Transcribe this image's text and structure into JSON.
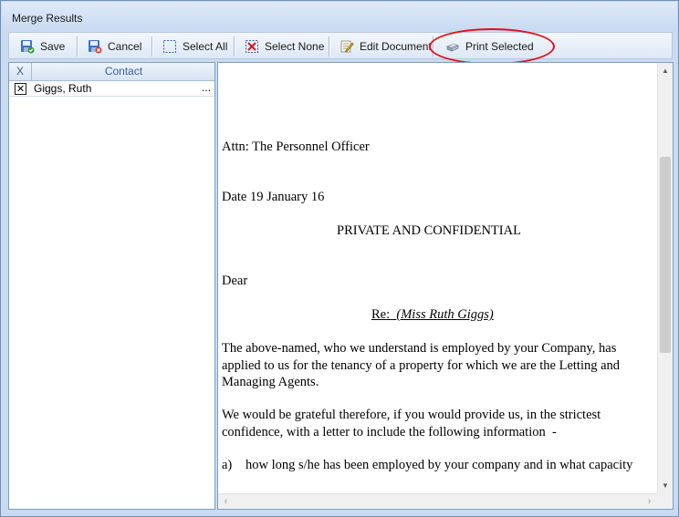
{
  "window": {
    "title": "Merge Results"
  },
  "toolbar": {
    "save_label": "Save",
    "cancel_label": "Cancel",
    "select_all_label": "Select All",
    "select_none_label": "Select None",
    "edit_document_label": "Edit Document",
    "print_selected_label": "Print Selected"
  },
  "grid": {
    "columns": [
      "X",
      "Contact"
    ],
    "rows": [
      {
        "checked_mark": "✕",
        "contact": "Giggs, Ruth",
        "more": "..."
      }
    ]
  },
  "document": {
    "attn": "Attn: The Personnel Officer",
    "date": "Date 19 January 16",
    "confidential": "PRIVATE AND CONFIDENTIAL",
    "salutation": "Dear",
    "re_label": "Re:",
    "re_name": "(Miss Ruth Giggs)",
    "para1_line1": "The above-named, who we understand is employed by your Company, has",
    "para1_line2": "applied to us for the tenancy of a property for which we are the Letting and",
    "para1_line3": "Managing Agents.",
    "para2_line1": "We would be grateful therefore, if you would provide us, in the strictest",
    "para2_line2": "confidence, with a letter to include the following information  -",
    "item_a_label": "a)",
    "item_a_text": "how long s/he has been employed by your company and in what capacity"
  },
  "icons": {
    "save": "save-icon",
    "cancel": "cancel-icon",
    "select_all": "select-all-icon",
    "select_none": "select-none-icon",
    "edit_document": "edit-document-icon",
    "print_selected": "print-icon"
  },
  "colors": {
    "highlight": "#e0101a",
    "grid_header_text": "#3a5f94",
    "window_frame": "#c9dbf1"
  }
}
